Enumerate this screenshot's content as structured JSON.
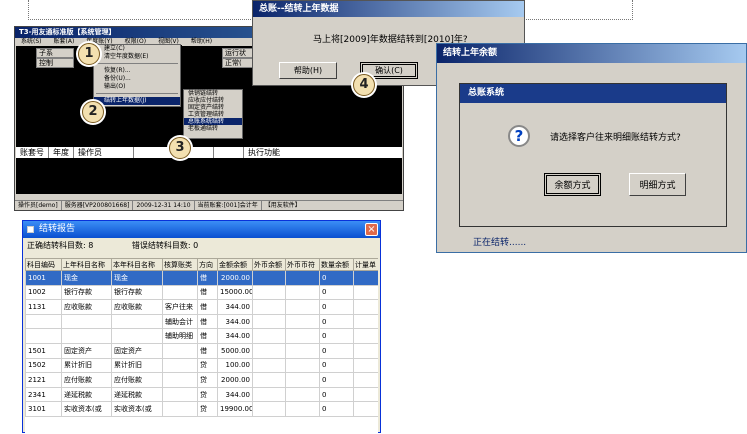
{
  "main_window": {
    "title": "T3-用友通标准版【系统管理】",
    "menu": [
      "系统(S)",
      "账套(A)",
      "年度账(Y)",
      "权限(O)",
      "视图(V)",
      "帮助(H)"
    ],
    "cells": {
      "c1": "子系",
      "c2": "控制",
      "c3": "运行状",
      "c4": "正常("
    },
    "year_menu": {
      "items": [
        "建立(C)",
        "清空年度数据(E)",
        "恢复(R)...",
        "备份(U)...",
        "输出(O)",
        "结转上年数据(J)"
      ]
    },
    "submenu": {
      "items": [
        "供销链结转",
        "应收应付结转",
        "固定资产结转",
        "工资管理结转",
        "总账系统结转",
        "老板通结转"
      ]
    },
    "grid_headers": [
      "账套号",
      "年度",
      "操作员",
      "",
      "",
      "执行功能"
    ],
    "status_bar": [
      "操作员[demo]",
      "服务器[VP200801668]",
      "2009-12-31 14:10",
      "当前账套:[001]会计年",
      "【用友软件】"
    ]
  },
  "badges": [
    "1",
    "2",
    "3",
    "4"
  ],
  "confirm_dialog": {
    "title": "总账--结转上年数据",
    "message": "马上将[2009]年数据结转到[2010]年?",
    "help_button": "帮助(H)",
    "ok_button": "确认(C)"
  },
  "report": {
    "title": "结转报告",
    "correct_count_label": "正确结转科目数: 8",
    "error_count_label": "错误结转科目数: 0",
    "headers": [
      "科目编码",
      "上年科目名称",
      "本年科目名称",
      "核算账类",
      "方向",
      "金额余额",
      "外币余额",
      "外币币符",
      "数量余额",
      "计量单"
    ],
    "rows": [
      [
        "1001",
        "现金",
        "现金",
        "",
        "借",
        "2000.00",
        "",
        "",
        "0",
        ""
      ],
      [
        "1002",
        "银行存款",
        "银行存款",
        "",
        "借",
        "15000.00",
        "",
        "",
        "0",
        ""
      ],
      [
        "1131",
        "应收账款",
        "应收账款",
        "客户往来",
        "借",
        "344.00",
        "",
        "",
        "0",
        ""
      ],
      [
        "",
        "",
        "",
        "辅助会计",
        "借",
        "344.00",
        "",
        "",
        "0",
        ""
      ],
      [
        "",
        "",
        "",
        "辅助明细",
        "借",
        "344.00",
        "",
        "",
        "0",
        ""
      ],
      [
        "1501",
        "固定资产",
        "固定资产",
        "",
        "借",
        "5000.00",
        "",
        "",
        "0",
        ""
      ],
      [
        "1502",
        "累计折旧",
        "累计折旧",
        "",
        "贷",
        "100.00",
        "",
        "",
        "0",
        ""
      ],
      [
        "2121",
        "应付账款",
        "应付账款",
        "",
        "贷",
        "2000.00",
        "",
        "",
        "0",
        ""
      ],
      [
        "2341",
        "递延税款",
        "递延税款",
        "",
        "贷",
        "344.00",
        "",
        "",
        "0",
        ""
      ],
      [
        "3101",
        "实收资本(或",
        "实收资本(或",
        "",
        "贷",
        "19900.00",
        "",
        "",
        "0",
        ""
      ]
    ]
  },
  "transfer_dialog": {
    "title": "结转上年余额",
    "status": "正在结转......",
    "gl_dialog": {
      "title": "总账系统",
      "message": "请选择客户往来明细账结转方式?",
      "amount_button": "余额方式",
      "detail_button": "明细方式"
    }
  },
  "colors": {
    "title_blue": "#0a246a",
    "selection": "#316ac5",
    "xp_close": "#e06a4a"
  }
}
